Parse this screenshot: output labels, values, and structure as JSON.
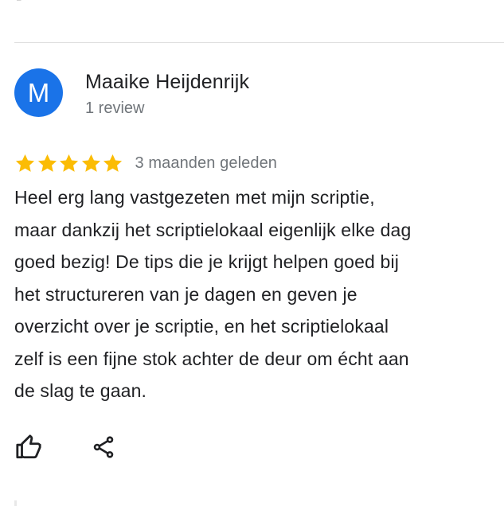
{
  "colors": {
    "avatar_bg": "#1a73e8",
    "star": "#fbbc04",
    "text": "#202124",
    "secondary": "#70757a"
  },
  "review": {
    "avatar_letter": "M",
    "author_name": "Maaike Heijdenrijk",
    "review_count": "1 review",
    "rating": 5,
    "rating_max": 5,
    "date": "3 maanden geleden",
    "text": "Heel erg lang vastgezeten met mijn scriptie,\nmaar dankzij het scriptielokaal eigenlijk elke dag\ngoed bezig! De tips die je krijgt helpen goed bij\nhet structureren van je dagen en geven je\noverzicht over je scriptie, en het scriptielokaal\nzelf is een fijne stok achter de deur om écht aan\nde slag te gaan."
  },
  "actions": {
    "like_icon": "thumbs-up-icon",
    "share_icon": "share-icon"
  }
}
